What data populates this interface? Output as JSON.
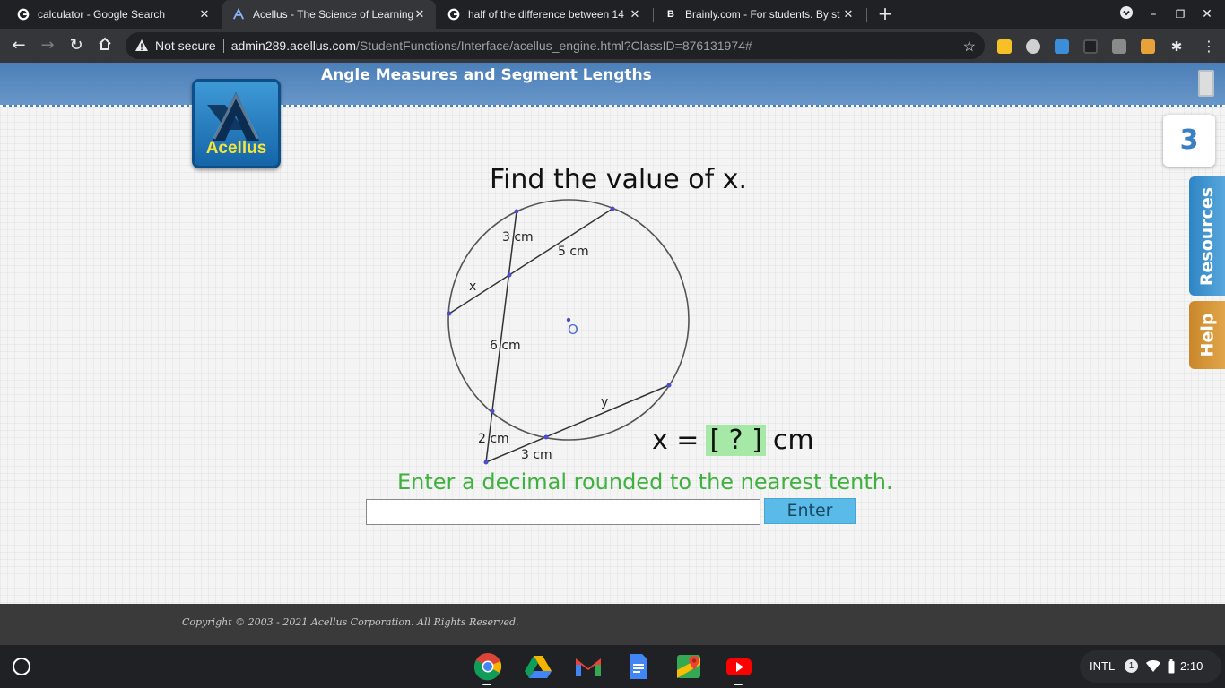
{
  "tabs": [
    {
      "title": "calculator - Google Search",
      "icon": "google-icon"
    },
    {
      "title": "Acellus - The Science of Learning",
      "icon": "acellus-icon"
    },
    {
      "title": "half of the difference between 14",
      "icon": "google-icon"
    },
    {
      "title": "Brainly.com - For students. By st",
      "icon": "brainly-icon"
    }
  ],
  "address": {
    "security": "Not secure",
    "host": "admin289.acellus.com",
    "path": "/StudentFunctions/Interface/acellus_engine.html?ClassID=876131974#"
  },
  "page": {
    "lesson_title": "Angle Measures and Segment Lengths",
    "logo_text": "Acellus",
    "counter": "3",
    "resources_label": "Resources",
    "help_label": "Help"
  },
  "problem": {
    "question": "Find the value of x.",
    "labels": {
      "seg_3cm": "3 cm",
      "seg_5cm": "5 cm",
      "seg_x": "x",
      "seg_6cm": "6 cm",
      "seg_y": "y",
      "seg_2cm": "2 cm",
      "seg_3cm_b": "3 cm",
      "center": "O"
    },
    "eq_left": "x =",
    "eq_box": "[ ? ]",
    "eq_unit": "cm",
    "instruction": "Enter a decimal rounded to the nearest tenth.",
    "answer_value": "",
    "enter_label": "Enter"
  },
  "footer": {
    "copyright": "Copyright © 2003 - 2021 Acellus Corporation.  All Rights Reserved."
  },
  "tray": {
    "keyboard": "INTL",
    "notifications": "1",
    "time": "2:10"
  },
  "colors": {
    "header": "#5a8cc0",
    "instruction": "#3fb13f",
    "answer_box": "#a6e8a6",
    "enter_button": "#5bbbe8",
    "resources": "#2e85c4",
    "help": "#d4962f"
  }
}
